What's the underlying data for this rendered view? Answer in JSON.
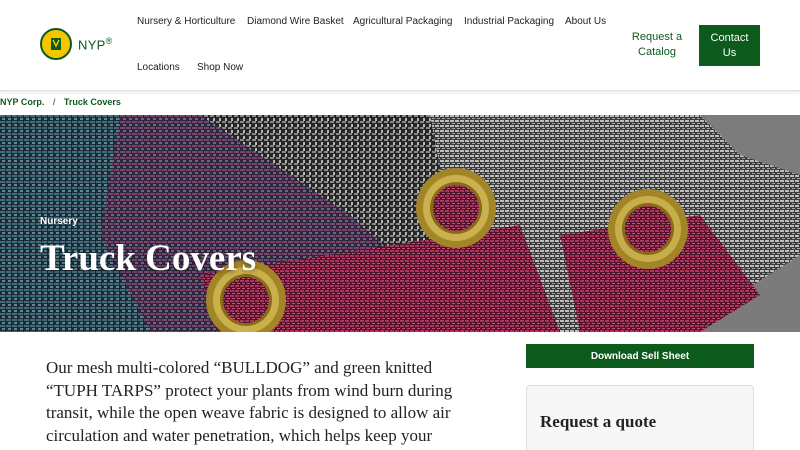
{
  "header": {
    "logo_text": "NYP",
    "logo_mark": "®",
    "nav": [
      {
        "label": "Nursery & Horticulture"
      },
      {
        "label": "Diamond Wire Basket"
      },
      {
        "label": "Agricultural Packaging"
      },
      {
        "label": "Industrial Packaging"
      },
      {
        "label": "About Us"
      },
      {
        "label": "Locations"
      },
      {
        "label": "Shop Now"
      }
    ],
    "catalog_label": "Request a Catalog",
    "contact_label": "Contact Us"
  },
  "breadcrumb": {
    "home": "NYP Corp.",
    "separator": "/",
    "current": "Truck Covers"
  },
  "hero": {
    "category": "Nursery",
    "title": "Truck Covers"
  },
  "content": {
    "description": "Our mesh multi-colored “BULLDOG” and green knitted “TUPH TARPS” protect your plants from wind burn during transit, while the open weave fabric is designed to allow air circulation and water penetration, which helps keep your"
  },
  "sidebar": {
    "download_label": "Download Sell Sheet",
    "quote_title": "Request a quote"
  },
  "colors": {
    "brand_green": "#0c5a1c",
    "logo_yellow": "#f4c600"
  }
}
